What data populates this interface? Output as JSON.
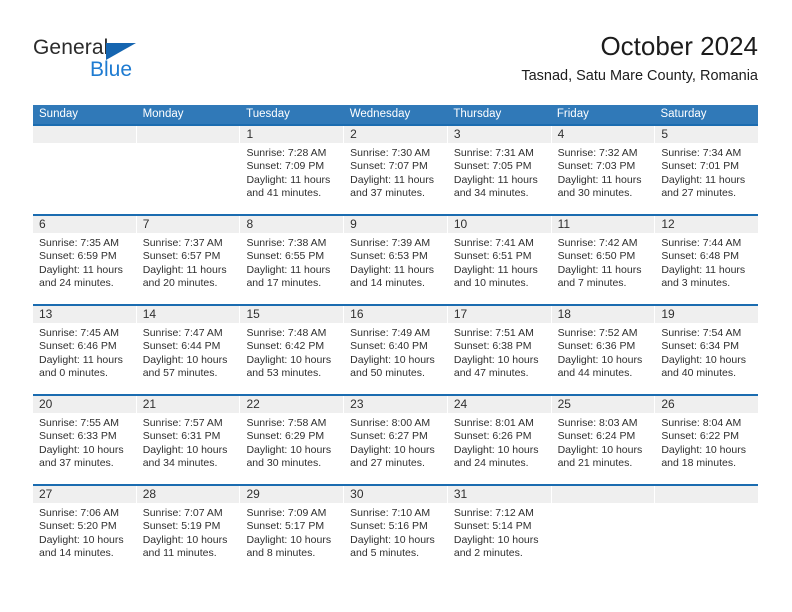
{
  "brand": {
    "name_part1": "General",
    "name_part2": "Blue"
  },
  "header": {
    "title": "October 2024",
    "subtitle": "Tasnad, Satu Mare County, Romania"
  },
  "calendar": {
    "day_headers": [
      "Sunday",
      "Monday",
      "Tuesday",
      "Wednesday",
      "Thursday",
      "Friday",
      "Saturday"
    ],
    "accent_color": "#3079b8",
    "rule_color": "#1b6cb0",
    "band_color": "#efefef",
    "weeks": [
      [
        {
          "day": ""
        },
        {
          "day": ""
        },
        {
          "day": "1",
          "sunrise": "Sunrise: 7:28 AM",
          "sunset": "Sunset: 7:09 PM",
          "daylight1": "Daylight: 11 hours",
          "daylight2": "and 41 minutes."
        },
        {
          "day": "2",
          "sunrise": "Sunrise: 7:30 AM",
          "sunset": "Sunset: 7:07 PM",
          "daylight1": "Daylight: 11 hours",
          "daylight2": "and 37 minutes."
        },
        {
          "day": "3",
          "sunrise": "Sunrise: 7:31 AM",
          "sunset": "Sunset: 7:05 PM",
          "daylight1": "Daylight: 11 hours",
          "daylight2": "and 34 minutes."
        },
        {
          "day": "4",
          "sunrise": "Sunrise: 7:32 AM",
          "sunset": "Sunset: 7:03 PM",
          "daylight1": "Daylight: 11 hours",
          "daylight2": "and 30 minutes."
        },
        {
          "day": "5",
          "sunrise": "Sunrise: 7:34 AM",
          "sunset": "Sunset: 7:01 PM",
          "daylight1": "Daylight: 11 hours",
          "daylight2": "and 27 minutes."
        }
      ],
      [
        {
          "day": "6",
          "sunrise": "Sunrise: 7:35 AM",
          "sunset": "Sunset: 6:59 PM",
          "daylight1": "Daylight: 11 hours",
          "daylight2": "and 24 minutes."
        },
        {
          "day": "7",
          "sunrise": "Sunrise: 7:37 AM",
          "sunset": "Sunset: 6:57 PM",
          "daylight1": "Daylight: 11 hours",
          "daylight2": "and 20 minutes."
        },
        {
          "day": "8",
          "sunrise": "Sunrise: 7:38 AM",
          "sunset": "Sunset: 6:55 PM",
          "daylight1": "Daylight: 11 hours",
          "daylight2": "and 17 minutes."
        },
        {
          "day": "9",
          "sunrise": "Sunrise: 7:39 AM",
          "sunset": "Sunset: 6:53 PM",
          "daylight1": "Daylight: 11 hours",
          "daylight2": "and 14 minutes."
        },
        {
          "day": "10",
          "sunrise": "Sunrise: 7:41 AM",
          "sunset": "Sunset: 6:51 PM",
          "daylight1": "Daylight: 11 hours",
          "daylight2": "and 10 minutes."
        },
        {
          "day": "11",
          "sunrise": "Sunrise: 7:42 AM",
          "sunset": "Sunset: 6:50 PM",
          "daylight1": "Daylight: 11 hours",
          "daylight2": "and 7 minutes."
        },
        {
          "day": "12",
          "sunrise": "Sunrise: 7:44 AM",
          "sunset": "Sunset: 6:48 PM",
          "daylight1": "Daylight: 11 hours",
          "daylight2": "and 3 minutes."
        }
      ],
      [
        {
          "day": "13",
          "sunrise": "Sunrise: 7:45 AM",
          "sunset": "Sunset: 6:46 PM",
          "daylight1": "Daylight: 11 hours",
          "daylight2": "and 0 minutes."
        },
        {
          "day": "14",
          "sunrise": "Sunrise: 7:47 AM",
          "sunset": "Sunset: 6:44 PM",
          "daylight1": "Daylight: 10 hours",
          "daylight2": "and 57 minutes."
        },
        {
          "day": "15",
          "sunrise": "Sunrise: 7:48 AM",
          "sunset": "Sunset: 6:42 PM",
          "daylight1": "Daylight: 10 hours",
          "daylight2": "and 53 minutes."
        },
        {
          "day": "16",
          "sunrise": "Sunrise: 7:49 AM",
          "sunset": "Sunset: 6:40 PM",
          "daylight1": "Daylight: 10 hours",
          "daylight2": "and 50 minutes."
        },
        {
          "day": "17",
          "sunrise": "Sunrise: 7:51 AM",
          "sunset": "Sunset: 6:38 PM",
          "daylight1": "Daylight: 10 hours",
          "daylight2": "and 47 minutes."
        },
        {
          "day": "18",
          "sunrise": "Sunrise: 7:52 AM",
          "sunset": "Sunset: 6:36 PM",
          "daylight1": "Daylight: 10 hours",
          "daylight2": "and 44 minutes."
        },
        {
          "day": "19",
          "sunrise": "Sunrise: 7:54 AM",
          "sunset": "Sunset: 6:34 PM",
          "daylight1": "Daylight: 10 hours",
          "daylight2": "and 40 minutes."
        }
      ],
      [
        {
          "day": "20",
          "sunrise": "Sunrise: 7:55 AM",
          "sunset": "Sunset: 6:33 PM",
          "daylight1": "Daylight: 10 hours",
          "daylight2": "and 37 minutes."
        },
        {
          "day": "21",
          "sunrise": "Sunrise: 7:57 AM",
          "sunset": "Sunset: 6:31 PM",
          "daylight1": "Daylight: 10 hours",
          "daylight2": "and 34 minutes."
        },
        {
          "day": "22",
          "sunrise": "Sunrise: 7:58 AM",
          "sunset": "Sunset: 6:29 PM",
          "daylight1": "Daylight: 10 hours",
          "daylight2": "and 30 minutes."
        },
        {
          "day": "23",
          "sunrise": "Sunrise: 8:00 AM",
          "sunset": "Sunset: 6:27 PM",
          "daylight1": "Daylight: 10 hours",
          "daylight2": "and 27 minutes."
        },
        {
          "day": "24",
          "sunrise": "Sunrise: 8:01 AM",
          "sunset": "Sunset: 6:26 PM",
          "daylight1": "Daylight: 10 hours",
          "daylight2": "and 24 minutes."
        },
        {
          "day": "25",
          "sunrise": "Sunrise: 8:03 AM",
          "sunset": "Sunset: 6:24 PM",
          "daylight1": "Daylight: 10 hours",
          "daylight2": "and 21 minutes."
        },
        {
          "day": "26",
          "sunrise": "Sunrise: 8:04 AM",
          "sunset": "Sunset: 6:22 PM",
          "daylight1": "Daylight: 10 hours",
          "daylight2": "and 18 minutes."
        }
      ],
      [
        {
          "day": "27",
          "sunrise": "Sunrise: 7:06 AM",
          "sunset": "Sunset: 5:20 PM",
          "daylight1": "Daylight: 10 hours",
          "daylight2": "and 14 minutes."
        },
        {
          "day": "28",
          "sunrise": "Sunrise: 7:07 AM",
          "sunset": "Sunset: 5:19 PM",
          "daylight1": "Daylight: 10 hours",
          "daylight2": "and 11 minutes."
        },
        {
          "day": "29",
          "sunrise": "Sunrise: 7:09 AM",
          "sunset": "Sunset: 5:17 PM",
          "daylight1": "Daylight: 10 hours",
          "daylight2": "and 8 minutes."
        },
        {
          "day": "30",
          "sunrise": "Sunrise: 7:10 AM",
          "sunset": "Sunset: 5:16 PM",
          "daylight1": "Daylight: 10 hours",
          "daylight2": "and 5 minutes."
        },
        {
          "day": "31",
          "sunrise": "Sunrise: 7:12 AM",
          "sunset": "Sunset: 5:14 PM",
          "daylight1": "Daylight: 10 hours",
          "daylight2": "and 2 minutes."
        },
        {
          "day": ""
        },
        {
          "day": ""
        }
      ]
    ]
  }
}
